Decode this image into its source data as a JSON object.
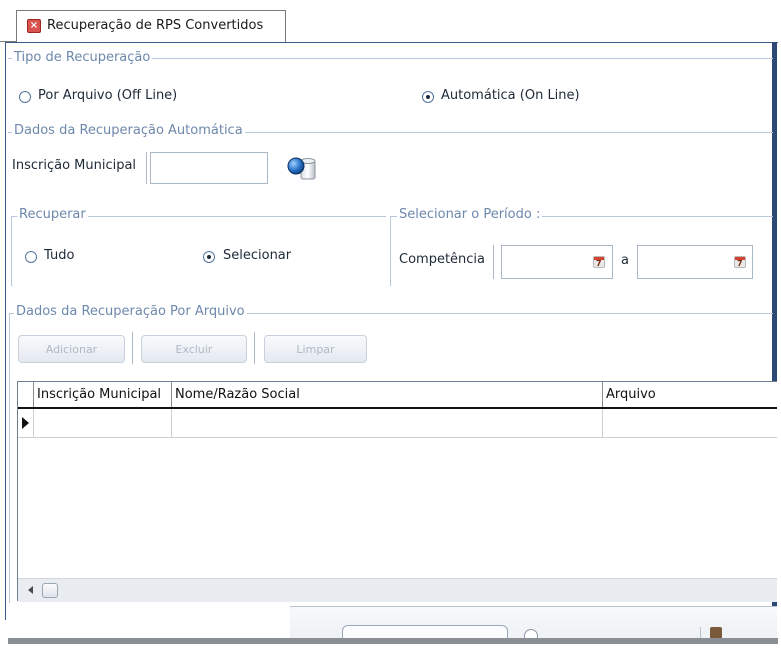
{
  "tab": {
    "title": "Recuperação de RPS Convertidos",
    "close_icon": "close-icon"
  },
  "tipo": {
    "legend": "Tipo de Recuperação",
    "options": [
      {
        "label": "Por Arquivo (Off Line)",
        "checked": false
      },
      {
        "label": "Automática (On Line)",
        "checked": true
      }
    ]
  },
  "automatica": {
    "legend": "Dados da Recuperação Automática",
    "inscricao_label": "Inscrição Municipal",
    "inscricao_value": "",
    "lookup_icon": "lookup-icon"
  },
  "recuperar": {
    "legend": "Recuperar",
    "options": [
      {
        "label": "Tudo",
        "checked": false
      },
      {
        "label": "Selecionar",
        "checked": true
      }
    ]
  },
  "periodo": {
    "legend": "Selecionar o Período :",
    "competencia_label": "Competência",
    "from_value": "",
    "to_label": "a",
    "to_value": "",
    "calendar_icon": "calendar-icon"
  },
  "arquivo": {
    "legend": "Dados da Recuperação Por Arquivo",
    "buttons": [
      "Adicionar",
      "Excluir",
      "Limpar"
    ],
    "columns": [
      "Inscrição Municipal",
      "Nome/Razão Social",
      "Arquivo"
    ]
  }
}
